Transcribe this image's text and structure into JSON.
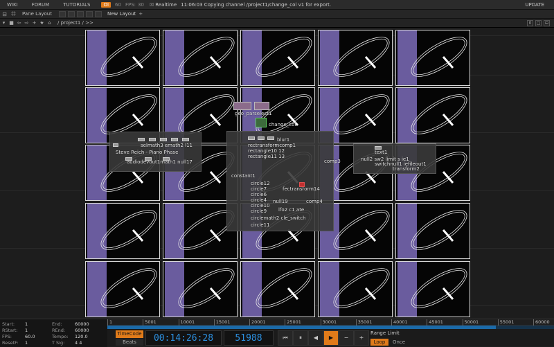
{
  "topbar": {
    "menu": [
      "WIKI",
      "FORUM",
      "TUTORIALS"
    ],
    "oi_badge": "OI",
    "fps_target": "60",
    "fps_label": "FPS:",
    "fps_value": "30",
    "realtime_label": "Realtime",
    "status_message": "11:06:03 Copying channel /project1/change_col v1 for export.",
    "update_label": "UPDATE"
  },
  "panebar": {
    "pane_layout_label": "Pane Layout",
    "new_layout_label": "New Layout",
    "add_label": "+"
  },
  "pathbar": {
    "path": "/ project1 / >>",
    "right_icons": [
      "0",
      "□",
      "⊟"
    ]
  },
  "network": {
    "nodes_left": {
      "line1": "selmath3  emath2 l11",
      "line2": "Steve Reich - Piano Phase",
      "line3": "audiodevout1math1 null17"
    },
    "geo_top": {
      "geo_label": "geo_parselect1",
      "change_col_label": "change_col"
    },
    "nodes_center": {
      "blur": "blur1",
      "rects": [
        "rectransformcomp1",
        "rectangle10 12",
        "rectangle11 13"
      ],
      "constant": "constant1",
      "comp3": "comp3",
      "circle12": "circle12",
      "circle7": "circle7",
      "circle6": "circle6",
      "circle4": "circle4",
      "circle10": "circle10",
      "circle9": "circle9",
      "circle11": "circle11",
      "ftrans14": "fectransform14",
      "comp4": "comp4",
      "null19": "null19",
      "lfo": "lfo2 c1 ate",
      "circmath": "circlemath2 cle_switch"
    },
    "nodes_right": {
      "text": "text1",
      "null": "null2 sw2 limit s  ie1",
      "sw": "switchnull1 iefileout1",
      "transform": "transform2"
    }
  },
  "stats": {
    "start_label": "Start:",
    "start_value": "1",
    "rstart_label": "RStart:",
    "rstart_value": "1",
    "fps_label": "FPS:",
    "fps_value": "60.0",
    "resetf_label": "ResetF:",
    "resetf_value": "1",
    "end_label": "End:",
    "end_value": "60000",
    "rend_label": "REnd:",
    "rend_value": "60000",
    "tempo_label": "Tempo:",
    "tempo_value": "120.0",
    "tsig_label": "T Sig:",
    "tsig_value": "4    4"
  },
  "timeline": {
    "ticks": [
      "1",
      "5001",
      "10001",
      "15001",
      "20001",
      "25001",
      "30001",
      "35001",
      "40001",
      "45001",
      "50001",
      "55001",
      "60000"
    ],
    "play_fraction": 0.87
  },
  "transport": {
    "timecode_label": "TimeCode",
    "beats_label": "Beats",
    "timecode": "00:14:26:28",
    "frame": "51988",
    "buttons": [
      "⏮",
      "⏸",
      "◀",
      "▶",
      "−",
      "+"
    ],
    "range_limit_label": "Range Limit",
    "loop_label": "Loop",
    "once_label": "Once"
  },
  "colors": {
    "accent": "#e07b1a",
    "timecode": "#2c90e0",
    "tile_stripe": "#6a5c9e",
    "tile_bg": "#050505"
  }
}
